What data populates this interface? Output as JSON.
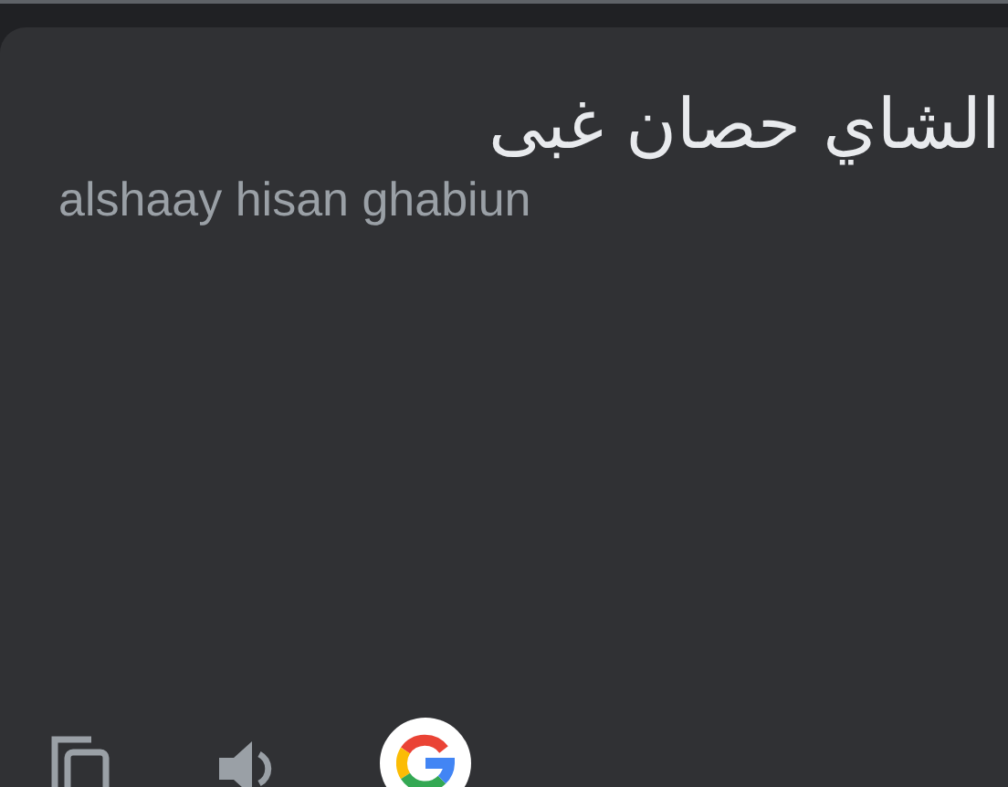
{
  "translation": {
    "text": "الشاي حصان غبى",
    "transliteration": "alshaay hisan ghabiun"
  }
}
